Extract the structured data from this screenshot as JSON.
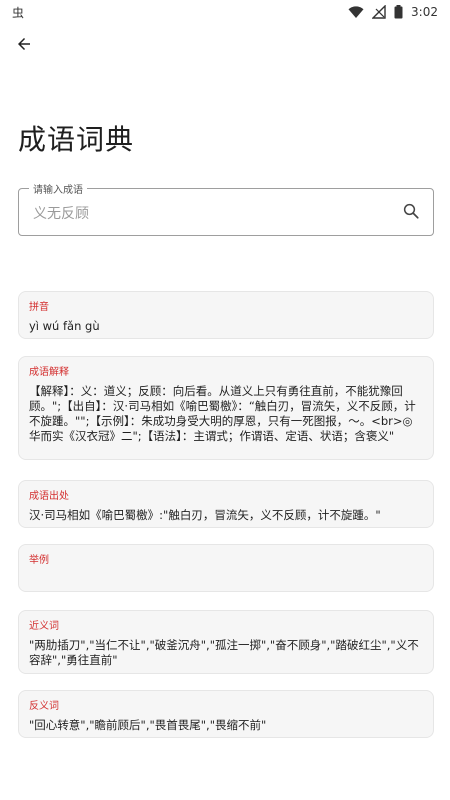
{
  "status_bar": {
    "left_glyph": "虫",
    "time": "3:02"
  },
  "page": {
    "title": "成语词典"
  },
  "search": {
    "label": "请输入成语",
    "placeholder": "义无反顾"
  },
  "cards": {
    "pinyin": {
      "label": "拼音",
      "value": "yì wú fǎn gù"
    },
    "explanation": {
      "label": "成语解释",
      "value": "【解释】：义：道义；反顾：向后看。从道义上只有勇往直前，不能犹豫回顾。\";【出自】：汉·司马相如《喻巴蜀檄》：“触白刃，冒流矢，义不反顾，计不旋踵。\"\";【示例】：朱成功身受大明的厚恩，只有一死图报，～。<br>◎华而实《汉衣冠》二\";【语法】：主谓式；作谓语、定语、状语；含褒义\""
    },
    "source": {
      "label": "成语出处",
      "value": "汉·司马相如《喻巴蜀檄》:\"触白刃，冒流矢，义不反顾，计不旋踵。\""
    },
    "example": {
      "label": "举例",
      "value": ""
    },
    "synonyms": {
      "label": "近义词",
      "value": "\"两肋插刀\",\"当仁不让\",\"破釜沉舟\",\"孤注一掷\",\"奋不顾身\",\"踏破红尘\",\"义不容辞\",\"勇往直前\""
    },
    "antonyms": {
      "label": "反义词",
      "value": "\"回心转意\",\"瞻前顾后\",\"畏首畏尾\",\"畏缩不前\""
    }
  },
  "icons": {
    "back": "arrow-left-icon",
    "search": "search-icon",
    "wifi": "wifi-icon",
    "signal": "signal-icon",
    "battery": "battery-icon"
  }
}
